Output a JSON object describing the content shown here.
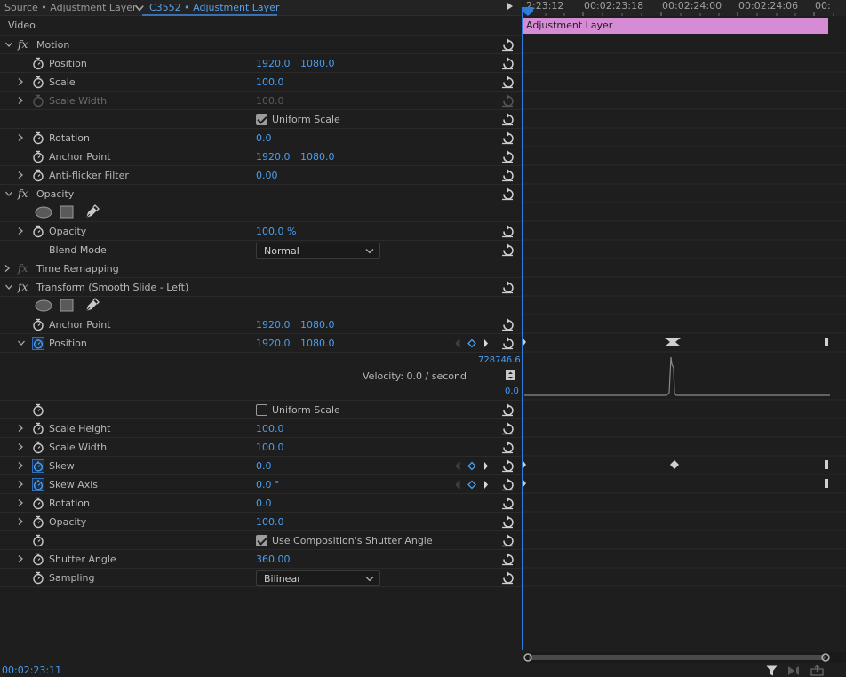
{
  "tabs": {
    "source": "Source • Adjustment Layer",
    "effect_controls": "C3552 • Adjustment Layer"
  },
  "ruler": {
    "ticks": [
      "2:23:12",
      "00:02:23:18",
      "00:02:24:00",
      "00:02:24:06",
      "00:"
    ]
  },
  "clip": {
    "name": "Adjustment Layer",
    "color": "#d68bd5"
  },
  "section": {
    "video": "Video"
  },
  "motion": {
    "name": "Motion",
    "position": {
      "label": "Position",
      "x": "1920.0",
      "y": "1080.0"
    },
    "scale": {
      "label": "Scale",
      "value": "100.0"
    },
    "scale_width": {
      "label": "Scale Width",
      "value": "100.0"
    },
    "uniform_scale": {
      "label": "Uniform Scale",
      "checked": true
    },
    "rotation": {
      "label": "Rotation",
      "value": "0.0"
    },
    "anchor_point": {
      "label": "Anchor Point",
      "x": "1920.0",
      "y": "1080.0"
    },
    "anti_flicker": {
      "label": "Anti-flicker Filter",
      "value": "0.00"
    }
  },
  "opacity": {
    "name": "Opacity",
    "opacity": {
      "label": "Opacity",
      "value": "100.0 %"
    },
    "blend_mode": {
      "label": "Blend Mode",
      "value": "Normal"
    }
  },
  "time_remapping": {
    "name": "Time Remapping"
  },
  "transform": {
    "name": "Transform (Smooth Slide - Left)",
    "anchor_point": {
      "label": "Anchor Point",
      "x": "1920.0",
      "y": "1080.0"
    },
    "position": {
      "label": "Position",
      "x": "1920.0",
      "y": "1080.0"
    },
    "graph": {
      "max": "728746.6",
      "min": "0.0",
      "velocity": "Velocity: 0.0 / second"
    },
    "uniform_scale": {
      "label": "Uniform Scale",
      "checked": false
    },
    "scale_height": {
      "label": "Scale Height",
      "value": "100.0"
    },
    "scale_width": {
      "label": "Scale Width",
      "value": "100.0"
    },
    "skew": {
      "label": "Skew",
      "value": "0.0"
    },
    "skew_axis": {
      "label": "Skew Axis",
      "value": "0.0 °"
    },
    "rotation": {
      "label": "Rotation",
      "value": "0.0"
    },
    "opacity": {
      "label": "Opacity",
      "value": "100.0"
    },
    "use_comp_shutter": {
      "label": "Use Composition's Shutter Angle",
      "checked": true
    },
    "shutter_angle": {
      "label": "Shutter Angle",
      "value": "360.00"
    },
    "sampling": {
      "label": "Sampling",
      "value": "Bilinear"
    }
  },
  "footer": {
    "timecode": "00:02:23:11"
  },
  "colors": {
    "accent": "#4a9eef",
    "playhead": "#2f7ce0"
  }
}
